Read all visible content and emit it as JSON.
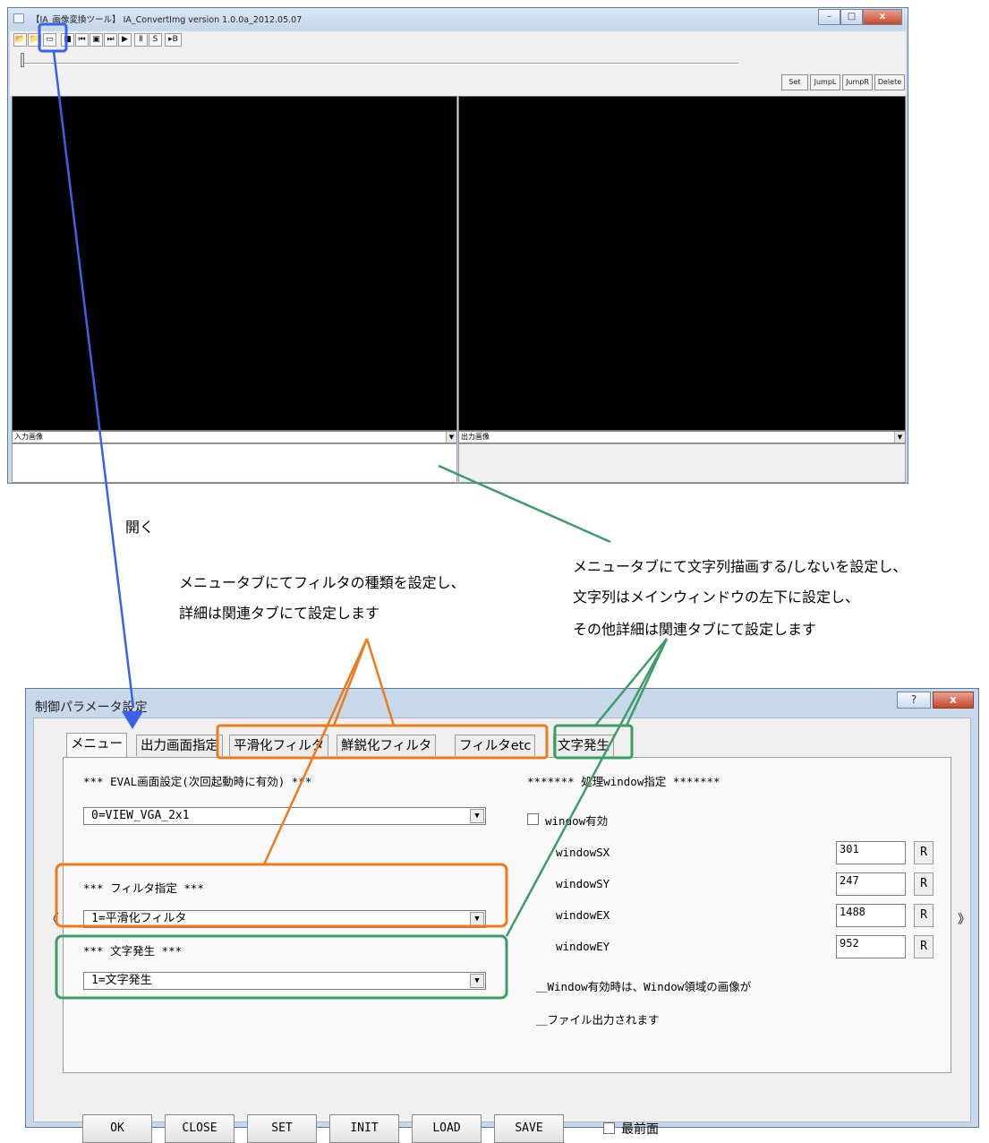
{
  "main_window": {
    "title": "【IA_画像変換ツール】 IA_ConvertImg version 1.0.0a_2012.05.07",
    "toolbar": [
      {
        "icon": "folder-open-icon",
        "glyph": "📂"
      },
      {
        "icon": "folder-save-icon",
        "glyph": "📁"
      },
      {
        "icon": "settings-dialog-icon",
        "glyph": "▭"
      },
      {
        "icon": "stop-icon",
        "glyph": "■"
      },
      {
        "icon": "skip-start-icon",
        "glyph": "⏮"
      },
      {
        "icon": "loop-icon",
        "glyph": "▣"
      },
      {
        "icon": "step-forward-icon",
        "glyph": "⏭"
      },
      {
        "icon": "play-icon",
        "glyph": "▶"
      },
      {
        "icon": "pause-icon",
        "glyph": "Ⅱ"
      },
      {
        "icon": "s-icon",
        "glyph": "S"
      },
      {
        "icon": "play-b-icon",
        "glyph": "▸B"
      }
    ],
    "buttons": {
      "set": "Set",
      "jumpl": "JumpL",
      "jumpr": "JumpR",
      "delete": "Delete"
    },
    "input_label": "入力画像",
    "output_label": "出力画像"
  },
  "annotations": {
    "open": "開く",
    "filter_note": [
      "メニュータブにてフィルタの種類を設定し、",
      "詳細は関連タブにて設定します"
    ],
    "text_note": [
      "メニュータブにて文字列描画する/しないを設定し、",
      "文字列はメインウィンドウの左下に設定し、",
      "その他詳細は関連タブにて設定します"
    ],
    "colors": {
      "blue": "#3a62e8",
      "orange": "#ee7a1e",
      "green": "#3e9c6a"
    }
  },
  "dialog": {
    "title": "制御パラメータ設定",
    "help": "?",
    "close": "x",
    "tabs": [
      "メニュー",
      "出力画面指定",
      "平滑化フィルタ",
      "鮮鋭化フィルタ",
      "フィルタetc",
      "文字発生"
    ],
    "eval_heading": "*** EVAL画面設定(次回起動時に有効) ***",
    "eval_value": "0=VIEW_VGA_2x1",
    "filter_heading": "*** フィルタ指定 ***",
    "filter_value": "1=平滑化フィルタ",
    "text_heading": "*** 文字発生 ***",
    "text_value": "1=文字発生",
    "window_heading": "******* 処理window指定 *******",
    "window_enable": "window有効",
    "fields": [
      {
        "label": "windowSX",
        "value": "301",
        "btn": "R"
      },
      {
        "label": "windowSY",
        "value": "247",
        "btn": "R"
      },
      {
        "label": "windowEX",
        "value": "1488",
        "btn": "R"
      },
      {
        "label": "windowEY",
        "value": "952",
        "btn": "R"
      }
    ],
    "note1": "＿Window有効時は、Window領域の画像が",
    "note2": "＿ファイル出力されます",
    "prev": "《",
    "next": "》",
    "buttons": [
      "OK",
      "CLOSE",
      "SET",
      "INIT",
      "LOAD",
      "SAVE"
    ],
    "topmost": "最前面"
  }
}
